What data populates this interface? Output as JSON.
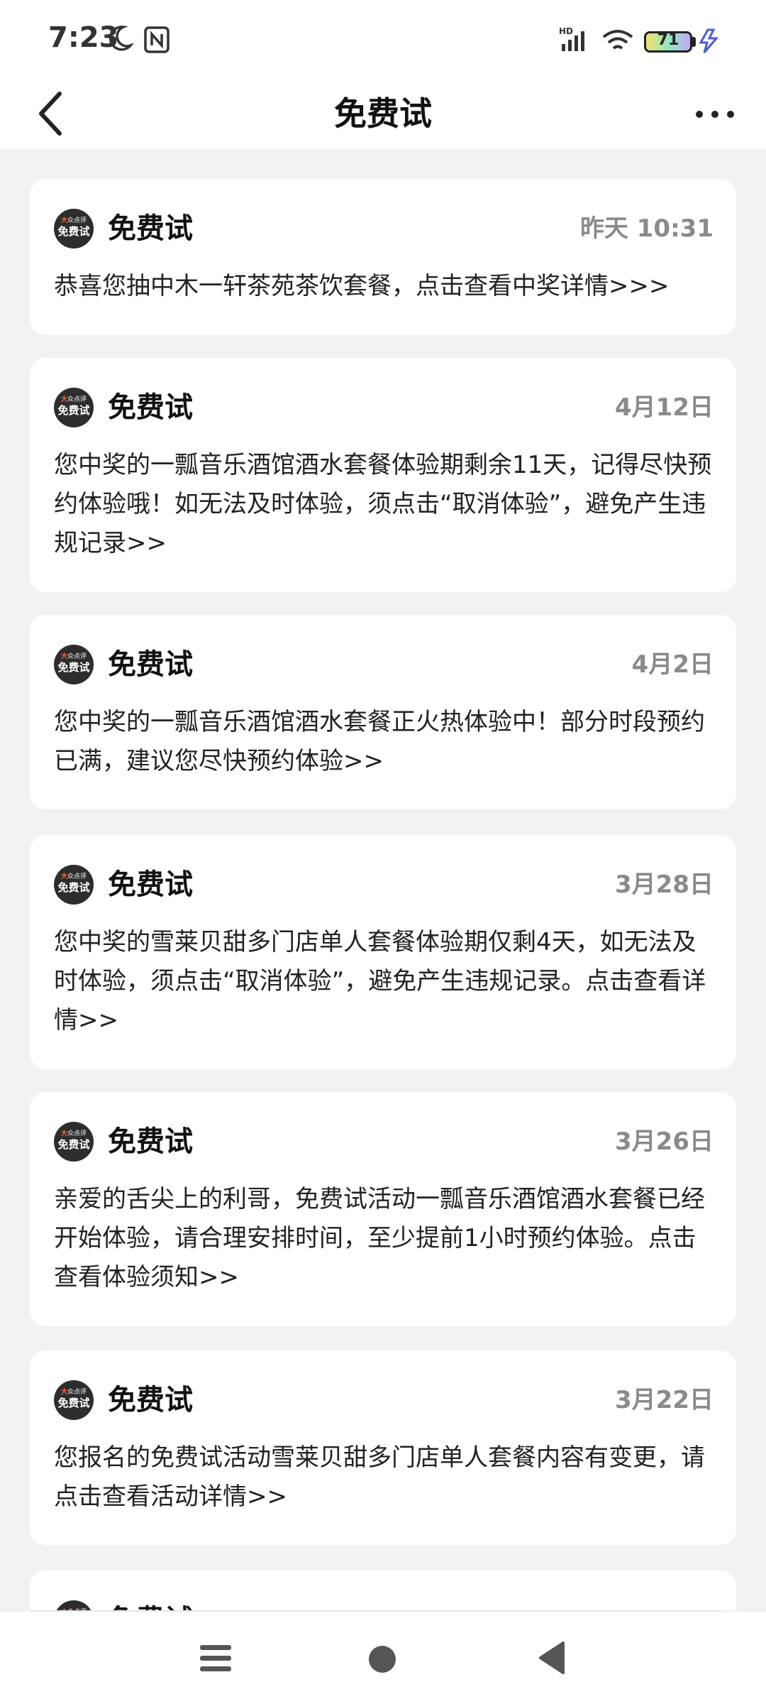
{
  "status_bar": {
    "time": "7:23",
    "battery_level": "71",
    "network_label": "HD"
  },
  "header": {
    "title": "免费试"
  },
  "avatar": {
    "line1_a": "大",
    "line1_b": "众点评",
    "line2": "免费试"
  },
  "messages": [
    {
      "sender": "免费试",
      "time": "昨天 10:31",
      "text": "恭喜您抽中木一轩茶苑茶饮套餐，点击查看中奖详情>>>"
    },
    {
      "sender": "免费试",
      "time": "4月12日",
      "text": "您中奖的一瓢音乐酒馆酒水套餐体验期剩余11天，记得尽快预约体验哦！如无法及时体验，须点击“取消体验”，避免产生违规记录>>"
    },
    {
      "sender": "免费试",
      "time": "4月2日",
      "text": "您中奖的一瓢音乐酒馆酒水套餐正火热体验中！部分时段预约已满，建议您尽快预约体验>>"
    },
    {
      "sender": "免费试",
      "time": "3月28日",
      "text": "您中奖的雪莱贝甜多门店单人套餐体验期仅剩4天，如无法及时体验，须点击“取消体验”，避免产生违规记录。点击查看详情>>"
    },
    {
      "sender": "免费试",
      "time": "3月26日",
      "text": "亲爱的舌尖上的利哥，免费试活动一瓢音乐酒馆酒水套餐已经开始体验，请合理安排时间，至少提前1小时预约体验。点击查看体验须知>>"
    },
    {
      "sender": "免费试",
      "time": "3月22日",
      "text": "您报名的免费试活动雪莱贝甜多门店单人套餐内容有变更，请点击查看活动详情>>"
    },
    {
      "sender": "免费试",
      "time": "",
      "text": ""
    }
  ],
  "icons": {
    "back": "back-arrow-icon",
    "more": "more-dots-icon",
    "moon": "moon-icon",
    "nfc": "nfc-icon",
    "nav_menu": "menu-icon",
    "nav_home": "home-circle-icon",
    "nav_back": "back-triangle-icon"
  }
}
